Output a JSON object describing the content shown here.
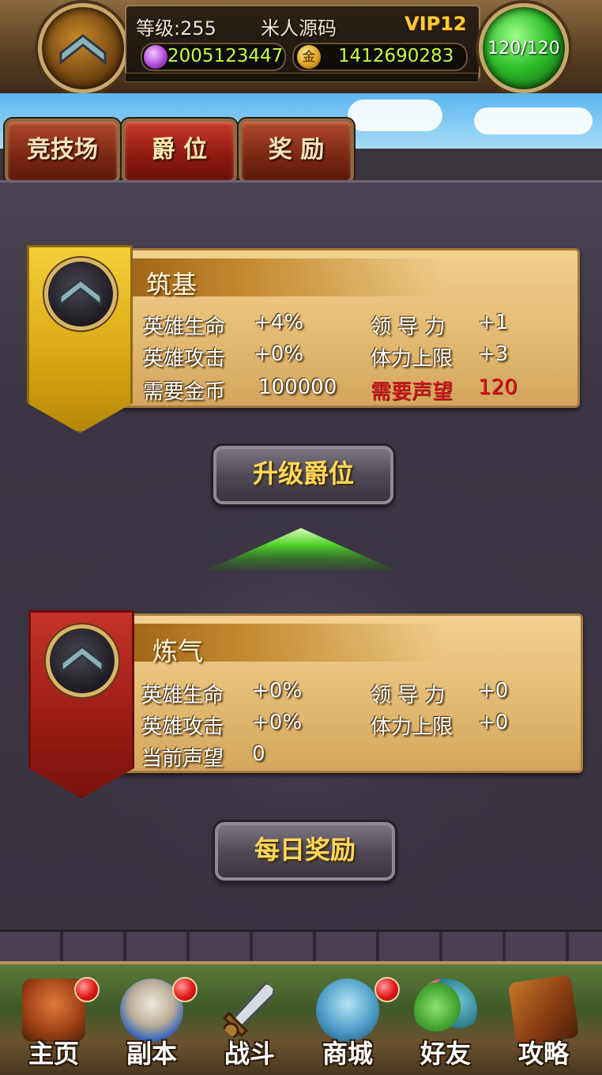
{
  "header": {
    "level": "等级:255",
    "player_name": "米人源码",
    "vip": "VIP12",
    "gems": "2005123447",
    "coins": "1412690283",
    "coin_glyph": "金",
    "stamina": "120/120"
  },
  "tabs": [
    {
      "label": "竞技场",
      "active": false
    },
    {
      "label": "爵 位",
      "active": true
    },
    {
      "label": "奖 励",
      "active": false
    }
  ],
  "next_rank": {
    "title": "筑基",
    "stats": [
      {
        "label": "英雄生命",
        "value": "+4%"
      },
      {
        "label": "英雄攻击",
        "value": "+0%"
      },
      {
        "label": "需要金币",
        "value": "100000"
      },
      {
        "label": "领 导 力",
        "value": "+1"
      },
      {
        "label": "体力上限",
        "value": "+3"
      },
      {
        "label": "需要声望",
        "value": "120"
      }
    ]
  },
  "upgrade_button": "升级爵位",
  "current_rank": {
    "title": "炼气",
    "stats": [
      {
        "label": "英雄生命",
        "value": "+0%"
      },
      {
        "label": "英雄攻击",
        "value": "+0%"
      },
      {
        "label": "当前声望",
        "value": "0"
      },
      {
        "label": "领 导 力",
        "value": "+0"
      },
      {
        "label": "体力上限",
        "value": "+0"
      }
    ]
  },
  "daily_reward_button": "每日奖励",
  "nav": [
    {
      "label": "主页",
      "icon": "house-icon",
      "badge": true
    },
    {
      "label": "副本",
      "icon": "skull-icon",
      "badge": true
    },
    {
      "label": "战斗",
      "icon": "sword-icon",
      "badge": false
    },
    {
      "label": "商城",
      "icon": "monster-icon",
      "badge": true
    },
    {
      "label": "好友",
      "icon": "friends-icon",
      "badge": false
    },
    {
      "label": "攻略",
      "icon": "book-icon",
      "badge": false
    }
  ],
  "colors": {
    "accent_gold": "#ffd85a",
    "warning_red": "#e3141a",
    "resource_green": "#c9ff3a"
  }
}
